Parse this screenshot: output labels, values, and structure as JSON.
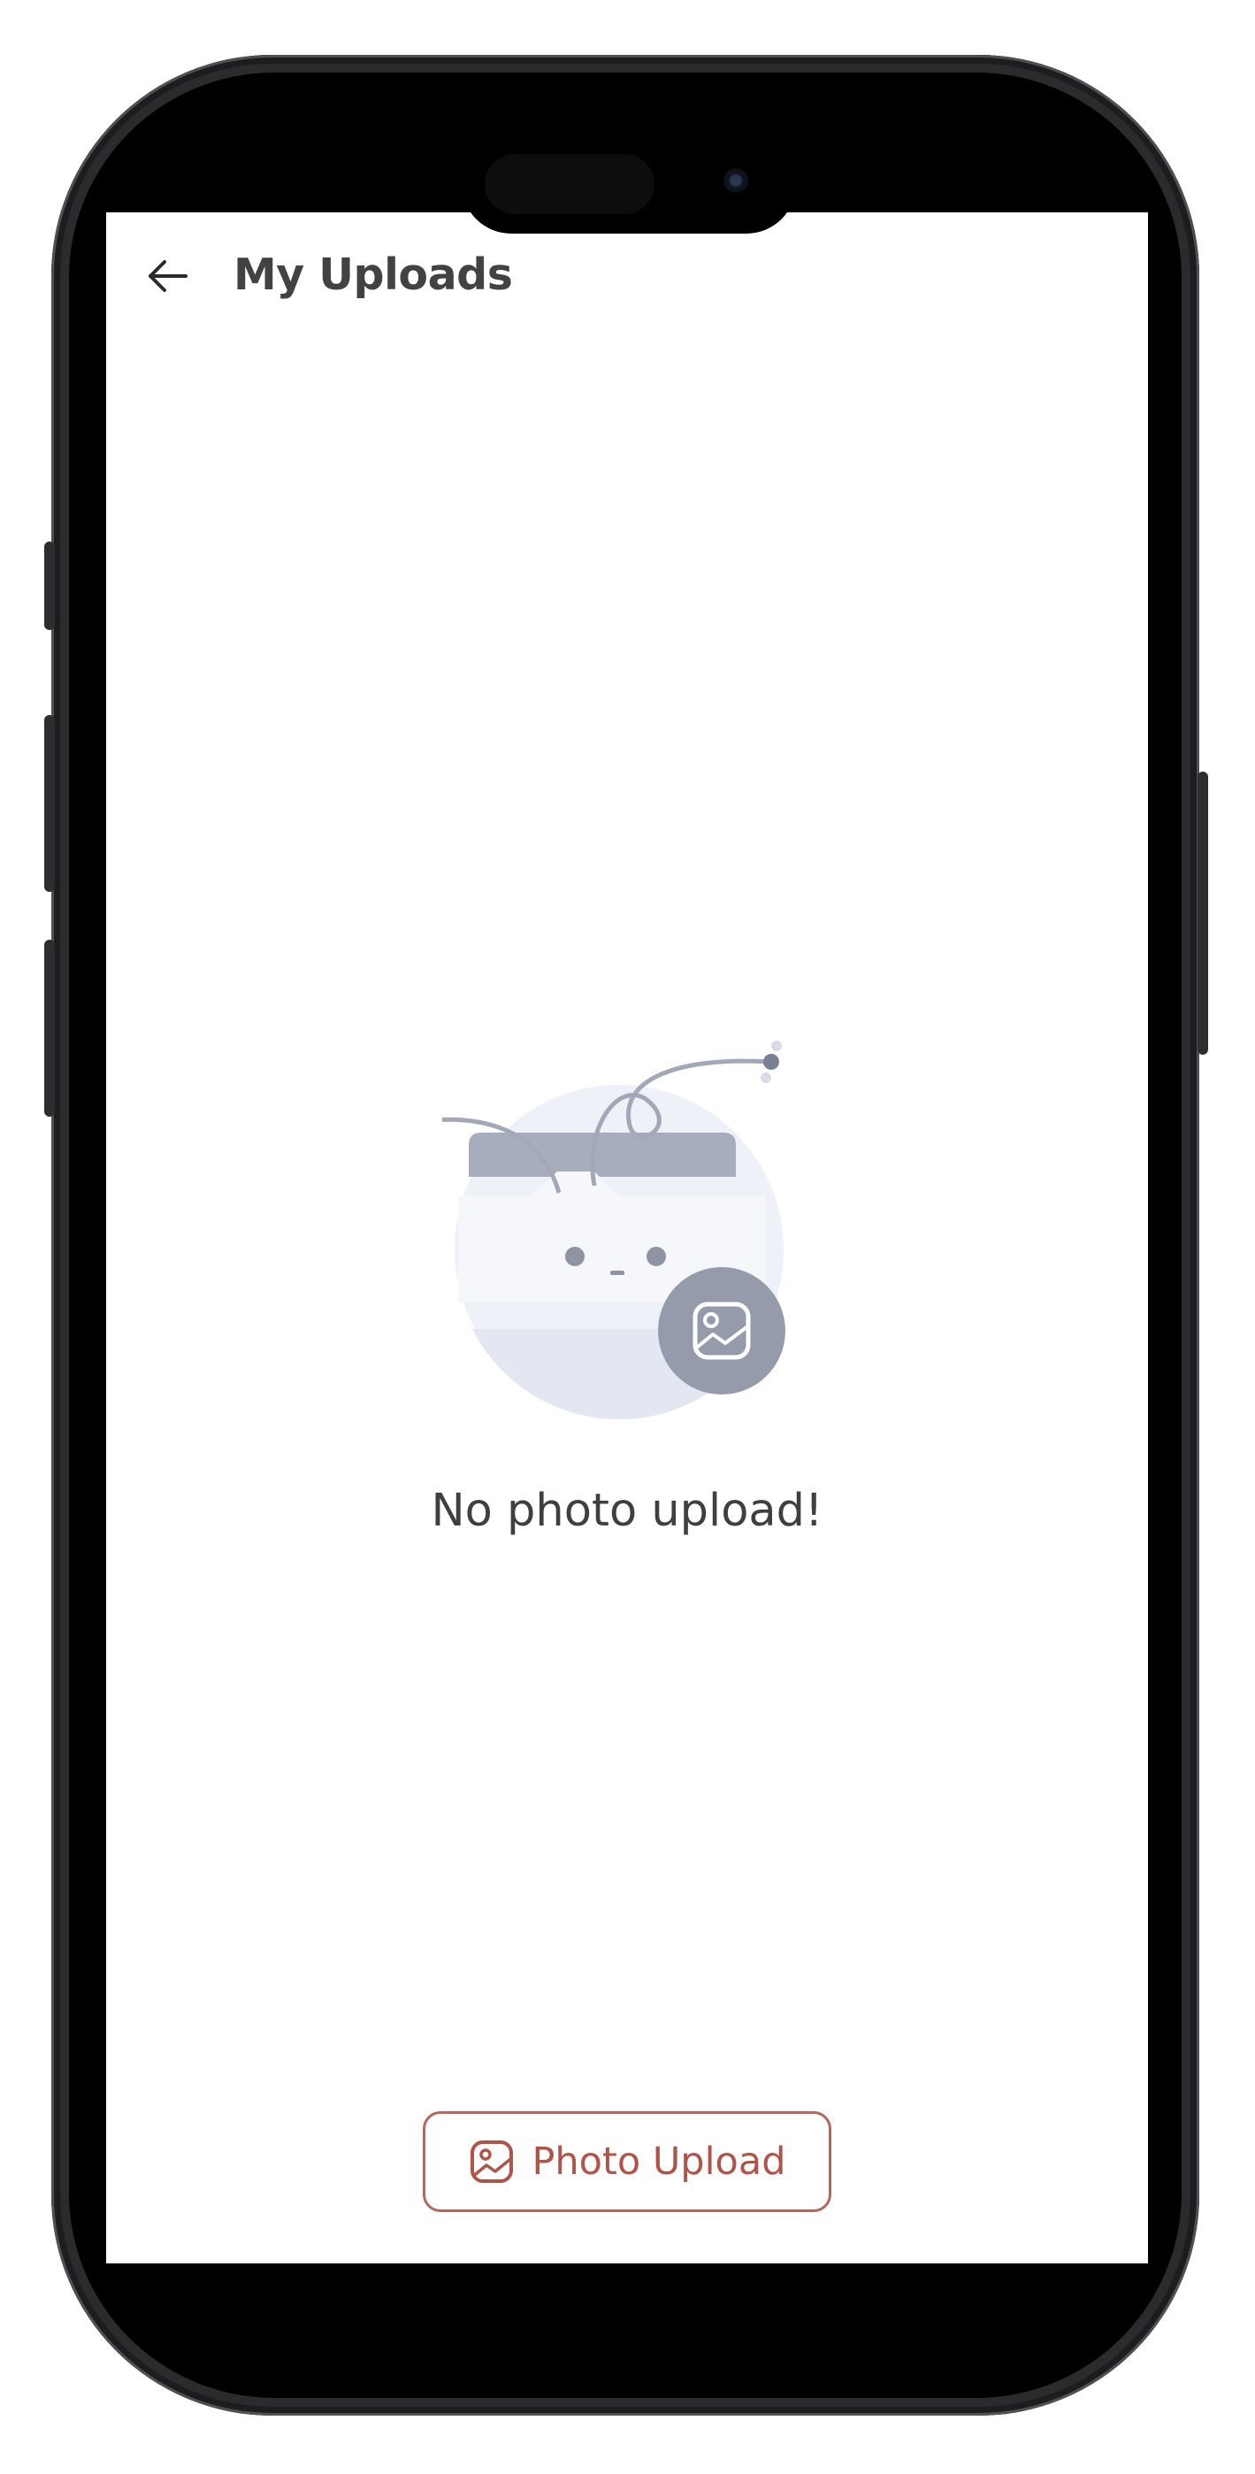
{
  "header": {
    "title": "My Uploads",
    "back_icon": "arrow-left-icon"
  },
  "empty_state": {
    "message": "No photo upload!",
    "illustration_icon": "empty-folder-photo-icon"
  },
  "upload_button": {
    "label": "Photo Upload",
    "icon": "image-icon"
  },
  "colors": {
    "accent": "#b0544a",
    "accent_border": "#b5675d",
    "title_text": "#424242",
    "body_text": "#3f3f3f",
    "illustration_gray": "#9aa1b2",
    "illustration_light": "#e9ecf6"
  }
}
